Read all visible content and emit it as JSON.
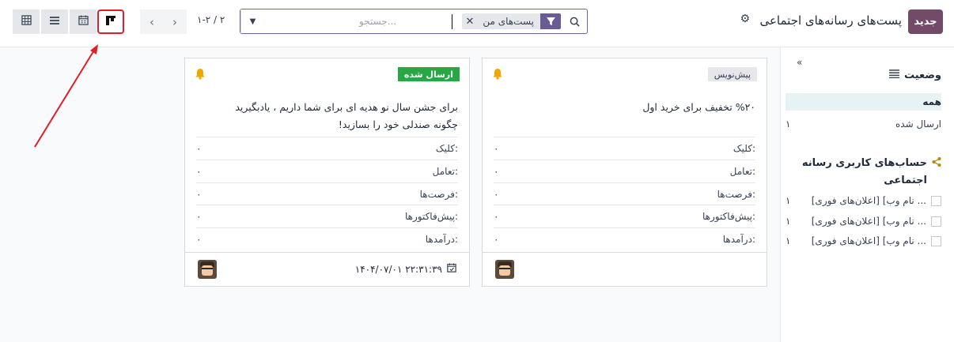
{
  "header": {
    "new_label": "جدید",
    "title": "پست‌های رسانه‌های اجتماعی"
  },
  "search": {
    "placeholder": "جستجو...",
    "facet_label": "پست‌های من"
  },
  "pager": {
    "value": "۱-۲ / ۲"
  },
  "sidebar": {
    "status_title": "وضعیت",
    "status_items": [
      {
        "label": "همه",
        "count": ""
      },
      {
        "label": "ارسال شده",
        "count": "۱"
      }
    ],
    "accounts_title": "حساب‌های کاربری رسانه اجتماعی",
    "accounts": [
      {
        "label": "[اعلان‌های فوری] [نام وب ...",
        "count": "۱"
      },
      {
        "label": "[اعلان‌های فوری] [نام وب ...",
        "count": "۱"
      },
      {
        "label": "[اعلان‌های فوری] [نام وب ...",
        "count": "۱"
      }
    ]
  },
  "stat_labels": [
    "کلیک:",
    "تعامل:",
    "فرصت‌ها:",
    "پیش‌فاکتورها:",
    "درآمدها:"
  ],
  "cards": [
    {
      "status": "پیش‌نویس",
      "message": "%۲۰ تخفیف برای خرید اول",
      "stats": [
        "۰",
        "۰",
        "۰",
        "۰",
        "۰"
      ]
    },
    {
      "status": "ارسال شده",
      "message_line1": "برای جشن سال نو هدیه ای برای شما داریم ، یادبگیرید",
      "message_line2": "چگونه صندلی خود را بسازید!",
      "stats": [
        "۰",
        "۰",
        "۰",
        "۰",
        "۰"
      ],
      "date": "۱۴۰۴/۰۷/۰۱ ۲۲:۳۱:۳۹"
    }
  ],
  "colors": {
    "brand": "#714b67",
    "sent_badge": "#28a745",
    "highlight": "#e11d2a"
  }
}
